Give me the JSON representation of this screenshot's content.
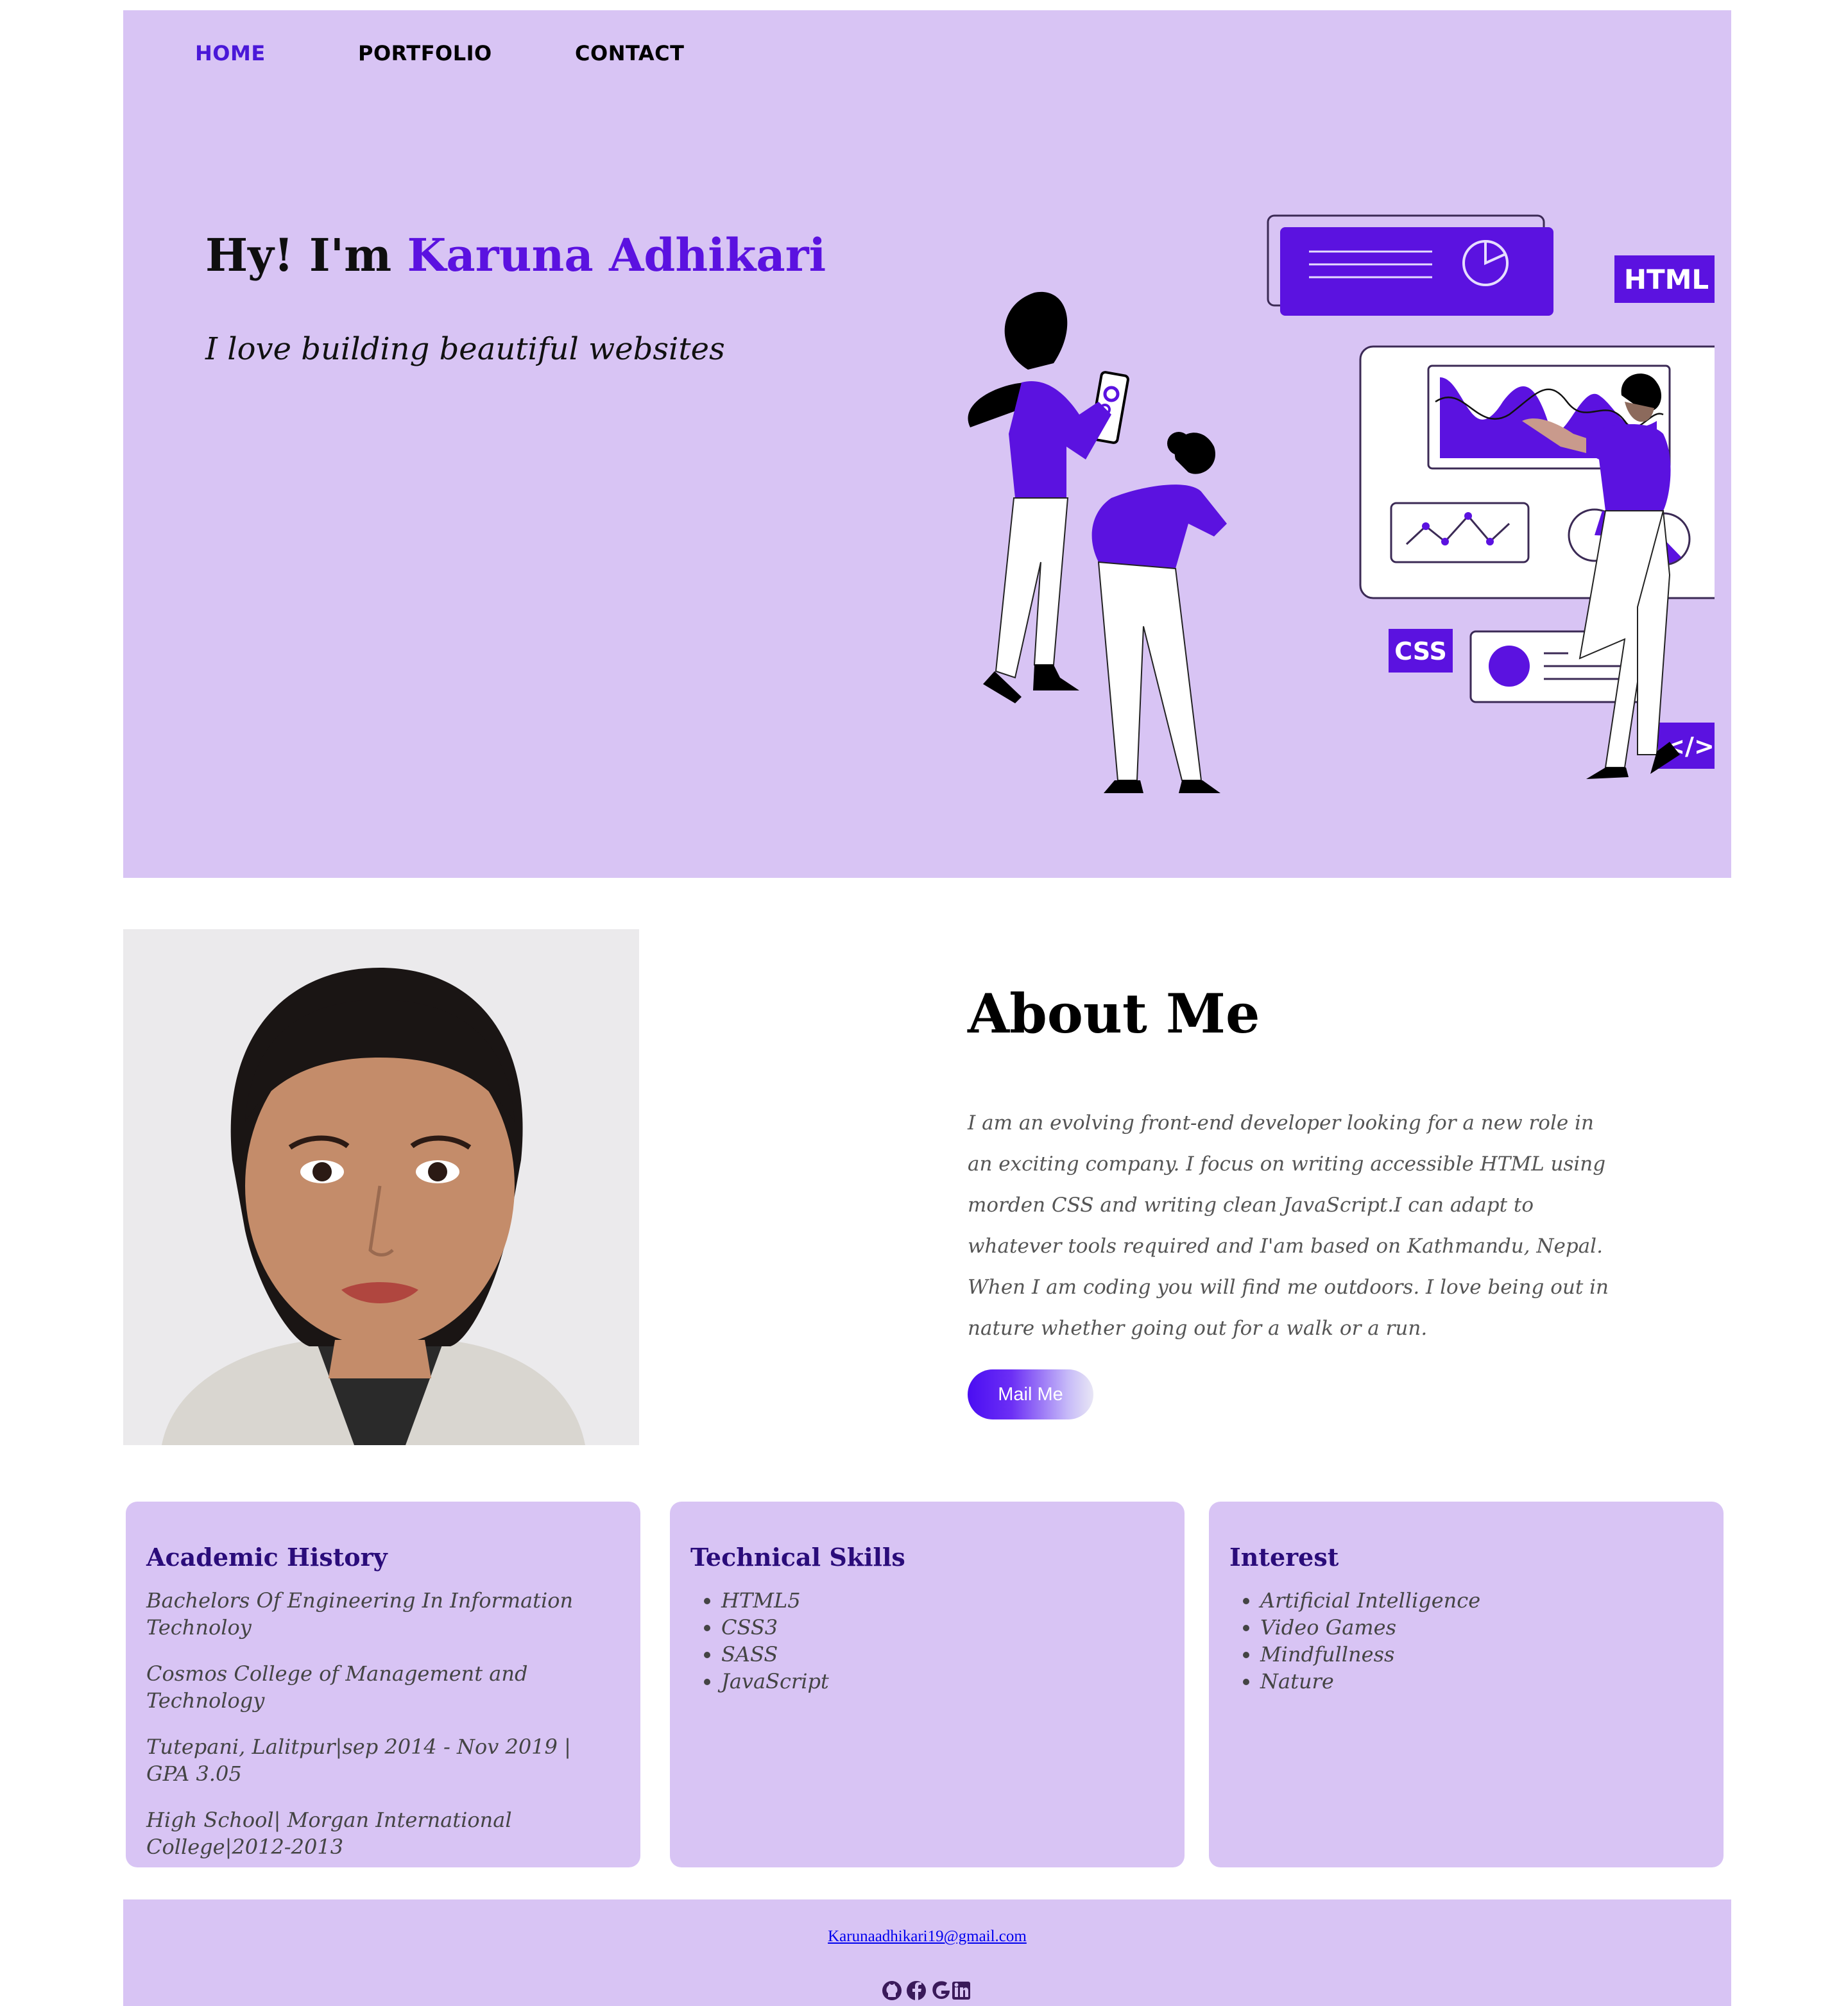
{
  "nav": {
    "home": "HOME",
    "portfolio": "PORTFOLIO",
    "contact": "CONTACT"
  },
  "hero": {
    "greeting": "Hy! I'm ",
    "name": "Karuna Adhikari",
    "subtitle": "I love building beautiful websites",
    "illustration_labels": {
      "html": "HTML",
      "css": "CSS",
      "code": "</>"
    }
  },
  "about": {
    "title": "About Me",
    "text": "I am an evolving front-end developer looking for a new role in an exciting company. I focus on writing accessible HTML using morden CSS and writing clean JavaScript.I can adapt to whatever tools required and I'am based on Kathmandu, Nepal. When I am coding you will find me outdoors. I love being out in nature whether going out for a walk or a run.",
    "button": "Mail Me"
  },
  "cards": {
    "academic": {
      "title": "Academic History",
      "items": [
        "Bachelors Of Engineering In Information Technoloy",
        "Cosmos College of Management and Technology",
        "Tutepani, Lalitpur|sep 2014 - Nov 2019 | GPA 3.05",
        "High School| Morgan International College|2012-2013"
      ]
    },
    "skills": {
      "title": "Technical Skills",
      "items": [
        "HTML5",
        "CSS3",
        "SASS",
        "JavaScript"
      ]
    },
    "interest": {
      "title": "Interest",
      "items": [
        "Artificial Intelligence",
        "Video Games",
        "Mindfullness",
        "Nature"
      ]
    }
  },
  "footer": {
    "email": "Karunaadhikari19@gmail.com",
    "icons": [
      "github-icon",
      "facebook-icon",
      "google-icon",
      "linkedin-icon"
    ]
  },
  "colors": {
    "accent": "#5b12e0",
    "lavender": "#d8c4f4",
    "card_title": "#2a0c7a"
  }
}
